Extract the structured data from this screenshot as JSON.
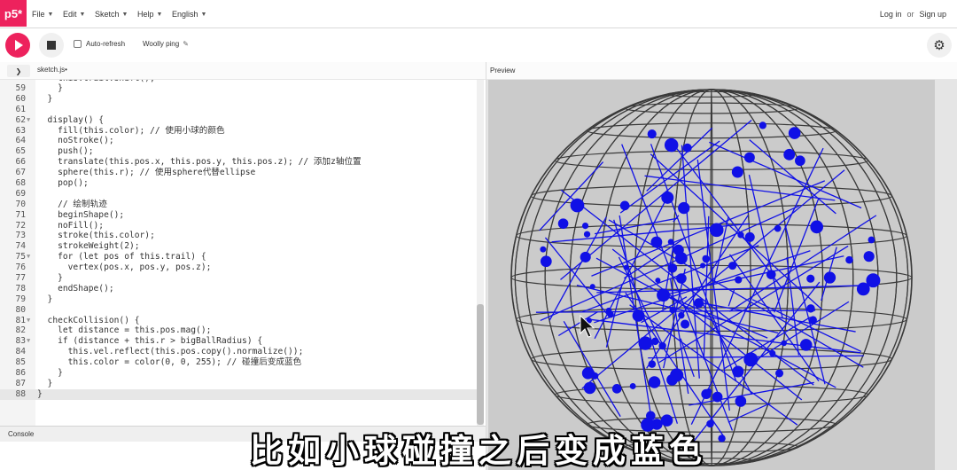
{
  "app": {
    "logo_text": "p5*",
    "brand_color": "#ed225d"
  },
  "menu": [
    {
      "label": "File"
    },
    {
      "label": "Edit"
    },
    {
      "label": "Sketch"
    },
    {
      "label": "Help"
    },
    {
      "label": "English"
    }
  ],
  "auth": {
    "login": "Log in",
    "or": "or",
    "signup": "Sign up"
  },
  "toolbar": {
    "play_icon": "play-icon",
    "stop_icon": "stop-icon",
    "auto_refresh_label": "Auto-refresh",
    "auto_refresh_checked": false,
    "sketch_name": "Woolly ping",
    "settings_icon": "gear-icon"
  },
  "editor": {
    "collapse_icon": "chevron-right-icon",
    "file_tab": "sketch.js•",
    "lines": [
      {
        "n": "59",
        "text": "    }"
      },
      {
        "n": "60",
        "text": "  }"
      },
      {
        "n": "61",
        "text": ""
      },
      {
        "n": "62",
        "fold": true,
        "text": "  display() {"
      },
      {
        "n": "63",
        "text": "    fill(this.color); // 使用小球的颜色"
      },
      {
        "n": "64",
        "text": "    noStroke();"
      },
      {
        "n": "65",
        "text": "    push();"
      },
      {
        "n": "66",
        "text": "    translate(this.pos.x, this.pos.y, this.pos.z); // 添加z轴位置"
      },
      {
        "n": "67",
        "text": "    sphere(this.r); // 使用sphere代替ellipse"
      },
      {
        "n": "68",
        "text": "    pop();"
      },
      {
        "n": "69",
        "text": ""
      },
      {
        "n": "70",
        "text": "    // 绘制轨迹"
      },
      {
        "n": "71",
        "text": "    beginShape();"
      },
      {
        "n": "72",
        "text": "    noFill();"
      },
      {
        "n": "73",
        "text": "    stroke(this.color);"
      },
      {
        "n": "74",
        "text": "    strokeWeight(2);"
      },
      {
        "n": "75",
        "fold": true,
        "text": "    for (let pos of this.trail) {"
      },
      {
        "n": "76",
        "text": "      vertex(pos.x, pos.y, pos.z);"
      },
      {
        "n": "77",
        "text": "    }"
      },
      {
        "n": "78",
        "text": "    endShape();"
      },
      {
        "n": "79",
        "text": "  }"
      },
      {
        "n": "80",
        "text": ""
      },
      {
        "n": "81",
        "fold": true,
        "text": "  checkCollision() {"
      },
      {
        "n": "82",
        "text": "    let distance = this.pos.mag();"
      },
      {
        "n": "83",
        "fold": true,
        "text": "    if (distance + this.r > bigBallRadius) {"
      },
      {
        "n": "84",
        "text": "      this.vel.reflect(this.pos.copy().normalize());"
      },
      {
        "n": "85",
        "text": "      this.color = color(0, 0, 255); // 碰撞后变成蓝色"
      },
      {
        "n": "86",
        "text": "    }"
      },
      {
        "n": "87",
        "text": "  }"
      },
      {
        "n": "88",
        "active": true,
        "text": "}"
      }
    ]
  },
  "console": {
    "label": "Console"
  },
  "preview": {
    "label": "Preview",
    "wire_color": "#3a3a3a",
    "ball_color": "#1010e6",
    "canvas_bg": "#cbcbcb"
  },
  "subtitle": "比如小球碰撞之后变成蓝色"
}
